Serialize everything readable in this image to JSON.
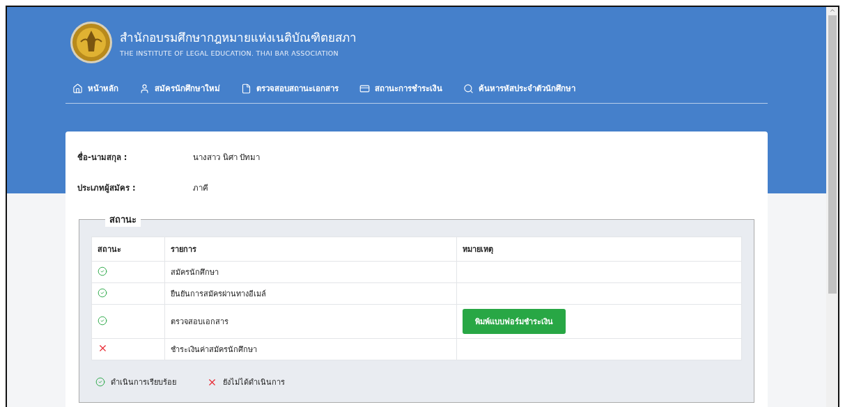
{
  "brand": {
    "title": "สำนักอบรมศึกษากฎหมายแห่งเนติบัณฑิตยสภา",
    "subtitle": "THE INSTITUTE OF LEGAL EDUCATION. THAI BAR ASSOCIATION"
  },
  "nav": [
    {
      "label": "หน้าหลัก"
    },
    {
      "label": "สมัครนักศึกษาใหม่"
    },
    {
      "label": "ตรวจสอบสถานะเอกสาร"
    },
    {
      "label": "สถานะการชำระเงิน"
    },
    {
      "label": "ค้นหารหัสประจำตัวนักศึกษา"
    }
  ],
  "profile": [
    {
      "label": "ชื่อ-นามสกุล :",
      "value": "นางสาว นิศา ปัทมา"
    },
    {
      "label": "ประเภทผู้สมัคร :",
      "value": "ภาคี"
    }
  ],
  "status": {
    "legend": "สถานะ",
    "columns": [
      "สถานะ",
      "รายการ",
      "หมายเหตุ"
    ],
    "rows": [
      {
        "kind": "done",
        "item": "สมัครนักศึกษา"
      },
      {
        "kind": "done",
        "item": "ยืนยันการสมัครผ่านทางอีเมล์"
      },
      {
        "kind": "done",
        "item": "ตรวจสอบเอกสาร",
        "button": "พิมพ์แบบฟอร์มชำระเงิน"
      },
      {
        "kind": "pending",
        "item": "ชำระเงินค่าสมัครนักศึกษา"
      }
    ],
    "key": [
      {
        "kind": "done",
        "label": "ดำเนินการเรียบร้อย"
      },
      {
        "kind": "pending",
        "label": "ยังไม่ได้ดำเนินการ"
      }
    ]
  }
}
